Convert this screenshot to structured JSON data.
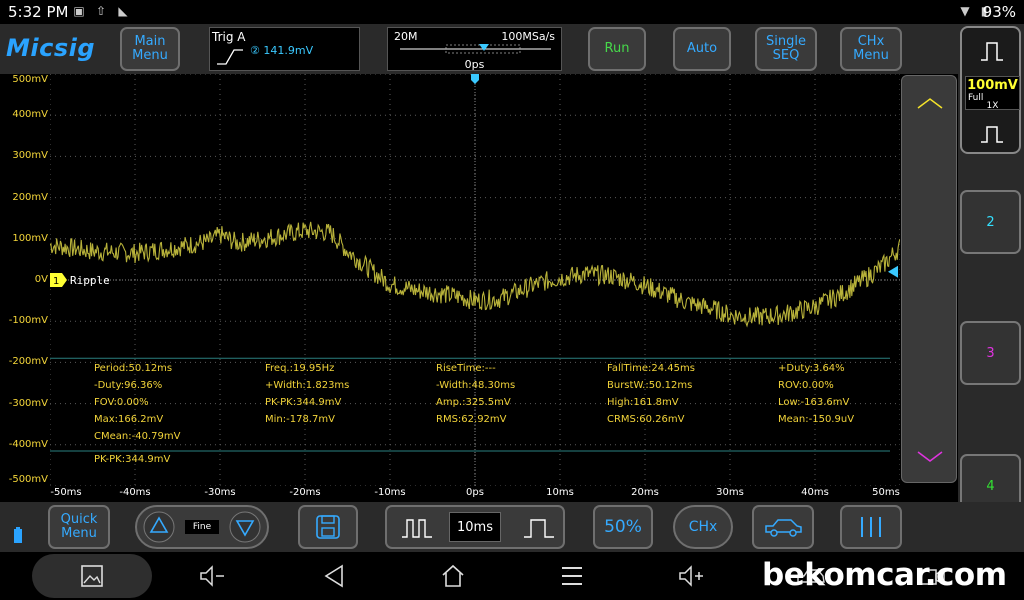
{
  "status": {
    "time": "5:32 PM",
    "battery": "93%"
  },
  "app": {
    "logo": "Micsig",
    "main_menu": "Main\nMenu",
    "run": "Run",
    "auto": "Auto",
    "single_seq": "Single\nSEQ",
    "chx_menu": "CHx\nMenu"
  },
  "trigger": {
    "label": "Trig A",
    "value": "② 141.9mV"
  },
  "timebase": {
    "memory": "20M",
    "sample_rate": "100MSa/s",
    "offset": "0ps"
  },
  "channels": {
    "ch1": {
      "volts": "100mV",
      "bandwidth": "Full",
      "probe": "1X",
      "label": "Ripple",
      "zero_marker": "1",
      "color": "#ffff33"
    },
    "ch2": {
      "label": "2",
      "color": "#33e0ff"
    },
    "ch3": {
      "label": "3",
      "color": "#e033e0"
    },
    "ch4": {
      "label": "4",
      "color": "#33e033"
    }
  },
  "chart_data": {
    "type": "line",
    "y_tick_labels": [
      "500mV",
      "400mV",
      "300mV",
      "200mV",
      "100mV",
      "0V",
      "-100mV",
      "-200mV",
      "-300mV",
      "-400mV",
      "-500mV"
    ],
    "x_tick_labels": [
      "-50ms",
      "-40ms",
      "-30ms",
      "-20ms",
      "-10ms",
      "0ps",
      "10ms",
      "20ms",
      "30ms",
      "40ms",
      "50ms"
    ],
    "xlim": [
      -50,
      50
    ],
    "ylim": [
      -500,
      500
    ],
    "grid": true,
    "series": [
      {
        "name": "Ripple",
        "color": "#b8b23a",
        "x": [
          -50,
          -45,
          -40,
          -35,
          -31,
          -30,
          -28,
          -25,
          -20,
          -17,
          -15,
          -12,
          -10,
          -7,
          -5,
          -2,
          0,
          3,
          6,
          8,
          10,
          13,
          16,
          19,
          22,
          25,
          28,
          30,
          33,
          36,
          40,
          43,
          46,
          48,
          50
        ],
        "y": [
          85,
          70,
          65,
          80,
          95,
          110,
          90,
          100,
          120,
          115,
          70,
          20,
          -10,
          -25,
          -30,
          -40,
          -50,
          -45,
          -20,
          -5,
          5,
          15,
          10,
          -5,
          -30,
          -55,
          -70,
          -85,
          -90,
          -85,
          -65,
          -35,
          5,
          35,
          80
        ]
      }
    ]
  },
  "measurements": [
    [
      "Period:50.12ms",
      "Freq.:19.95Hz",
      "RiseTime:---",
      "FallTime:24.45ms",
      "+Duty:3.64%"
    ],
    [
      "-Duty:96.36%",
      "+Width:1.823ms",
      "-Width:48.30ms",
      "BurstW.:50.12ms",
      "ROV:0.00%"
    ],
    [
      "FOV:0.00%",
      "PK-PK:344.9mV",
      "Amp.:325.5mV",
      "High:161.8mV",
      "Low:-163.6mV"
    ],
    [
      "Max:166.2mV",
      "Min:-178.7mV",
      "RMS:62.92mV",
      "CRMS:60.26mV",
      "Mean:-150.9uV"
    ],
    [
      "CMean:-40.79mV",
      "",
      "",
      "",
      ""
    ]
  ],
  "cursor_measure": "PK-PK:344.9mV",
  "bottom": {
    "quick_menu": "Quick\nMenu",
    "fine": "Fine",
    "timebase": "10ms",
    "fifty_percent": "50%",
    "chx": "CHx"
  },
  "watermark": "bekomcar.com"
}
